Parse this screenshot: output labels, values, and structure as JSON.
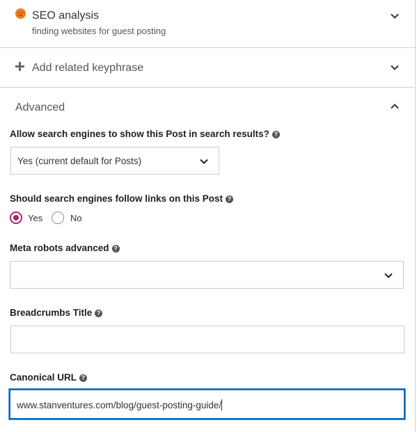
{
  "seo": {
    "title": "SEO analysis",
    "subtitle": "finding websites for guest posting",
    "status_color": "#ee7c1b",
    "status_icon": "sad-face-icon"
  },
  "related": {
    "icon": "plus-icon",
    "title": "Add related keyphrase"
  },
  "advanced": {
    "title": "Advanced",
    "search_results": {
      "label": "Allow search engines to show this Post in search results?",
      "selected": "Yes (current default for Posts)"
    },
    "follow_links": {
      "label": "Should search engines follow links on this Post",
      "options": [
        "Yes",
        "No"
      ],
      "selected": "Yes"
    },
    "meta_robots": {
      "label": "Meta robots advanced",
      "selected": ""
    },
    "breadcrumbs": {
      "label": "Breadcrumbs Title",
      "value": ""
    },
    "canonical": {
      "label": "Canonical URL",
      "value": "www.stanventures.com/blog/guest-posting-guide/"
    }
  },
  "colors": {
    "accent": "#a4286a",
    "focus": "#0066b6"
  }
}
